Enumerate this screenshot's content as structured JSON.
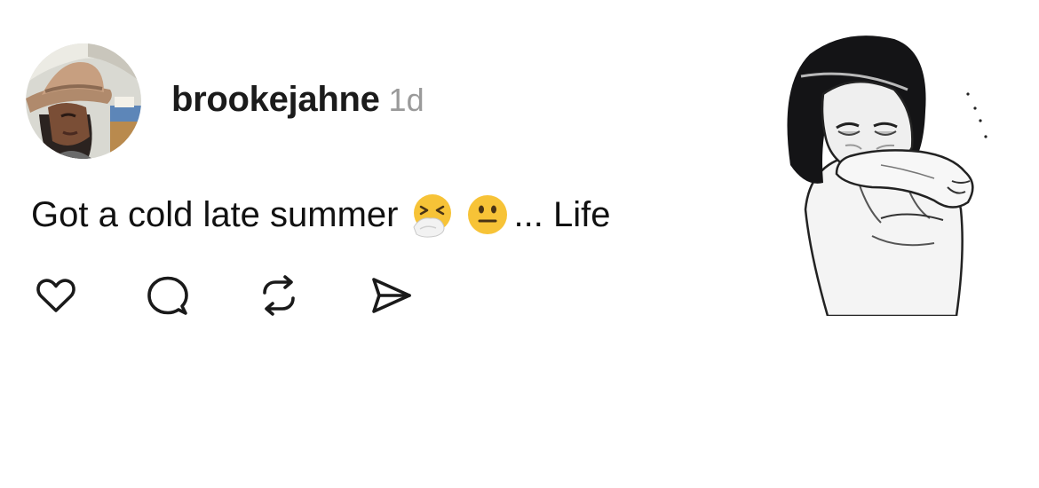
{
  "post": {
    "username": "brookejahne",
    "timestamp": "1d",
    "text_before_emoji": "Got a cold late summer",
    "emojis": [
      "sneezing-face-emoji",
      "neutral-face-emoji"
    ],
    "text_after_emoji": "... Life"
  },
  "icons": {
    "like": "heart-icon",
    "comment": "speech-bubble-icon",
    "repost": "repost-arrows-icon",
    "share": "paper-plane-icon"
  },
  "colors": {
    "text": "#111111",
    "timestamp": "#9a9a9a",
    "icon": "#1a1a1a",
    "emoji_yellow": "#f7c337"
  }
}
